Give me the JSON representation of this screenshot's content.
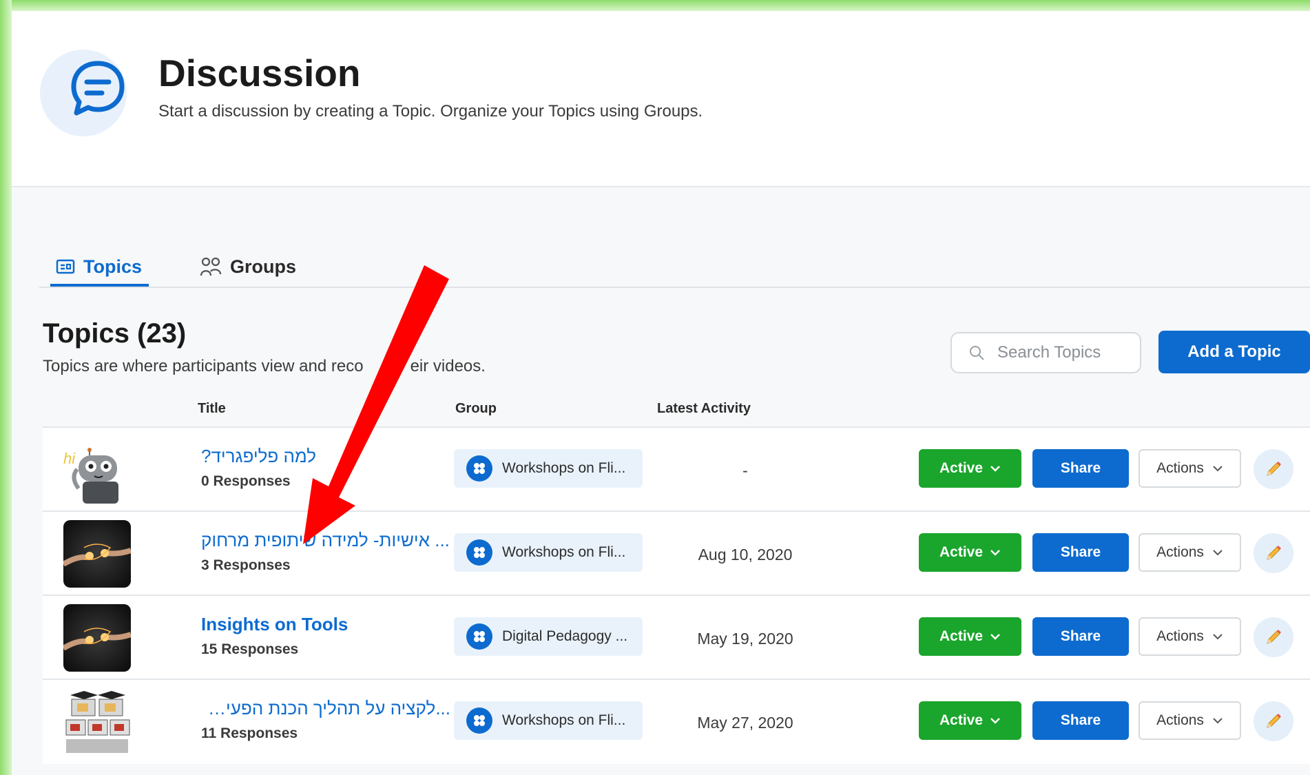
{
  "header": {
    "title": "Discussion",
    "subtitle": "Start a discussion by creating a Topic. Organize your Topics using Groups."
  },
  "tabs": [
    {
      "label": "Topics",
      "active": true,
      "icon": "topics-icon"
    },
    {
      "label": "Groups",
      "active": false,
      "icon": "groups-icon"
    }
  ],
  "section": {
    "title": "Topics (23)",
    "subtitle_before": "Topics are where participants view and reco",
    "subtitle_after": "eir videos."
  },
  "search": {
    "placeholder": "Search Topics",
    "value": ""
  },
  "add_button": "Add a Topic",
  "columns": {
    "title": "Title",
    "group": "Group",
    "latest_activity": "Latest Activity"
  },
  "topics": [
    {
      "title": "למה פליפגריד?",
      "responses": "0 Responses",
      "group": "Workshops on Fli...",
      "latest": "-",
      "status": "Active",
      "share": "Share",
      "actions": "Actions",
      "thumb": "robot-hi"
    },
    {
      "title": "... אישיות- למידה שיתופית מרחוק",
      "responses": "3 Responses",
      "group": "Workshops on Fli...",
      "latest": "Aug 10, 2020",
      "status": "Active",
      "share": "Share",
      "actions": "Actions",
      "thumb": "sparks"
    },
    {
      "title": "Insights on Tools",
      "responses": "15 Responses",
      "group": "Digital Pedagogy ...",
      "latest": "May 19, 2020",
      "status": "Active",
      "share": "Share",
      "actions": "Actions",
      "thumb": "sparks"
    },
    {
      "title": "...לקציה על תהליך הכנת הפעילות",
      "responses": "11 Responses",
      "group": "Workshops on Fli...",
      "latest": "May 27, 2020",
      "status": "Active",
      "share": "Share",
      "actions": "Actions",
      "thumb": "graduates"
    }
  ],
  "colors": {
    "brand_blue": "#0d6bcf",
    "active_green": "#1aa52c",
    "arrow_red": "#ff0000",
    "frame_green": "#8fdc6a"
  }
}
